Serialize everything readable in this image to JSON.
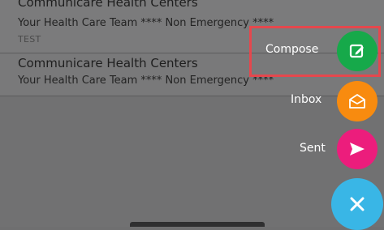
{
  "messages": [
    {
      "sender": "Communicare Health Centers",
      "subject": "Your Health Care Team **** Non Emergency ****",
      "preview": "TEST"
    },
    {
      "sender": "Communicare Health Centers",
      "subject": "Your Health Care Team **** Non Emergency ****",
      "preview": ""
    }
  ],
  "fab_menu": {
    "compose": {
      "label": "Compose",
      "icon": "edit-icon",
      "color": "#16a94a"
    },
    "inbox": {
      "label": "Inbox",
      "icon": "envelope-icon",
      "color": "#f88b0f"
    },
    "sent": {
      "label": "Sent",
      "icon": "send-icon",
      "color": "#ec1d7c"
    },
    "close": {
      "icon": "close-icon",
      "color": "#39b6e6"
    }
  },
  "highlight": {
    "target": "compose",
    "color": "#e5474d"
  }
}
